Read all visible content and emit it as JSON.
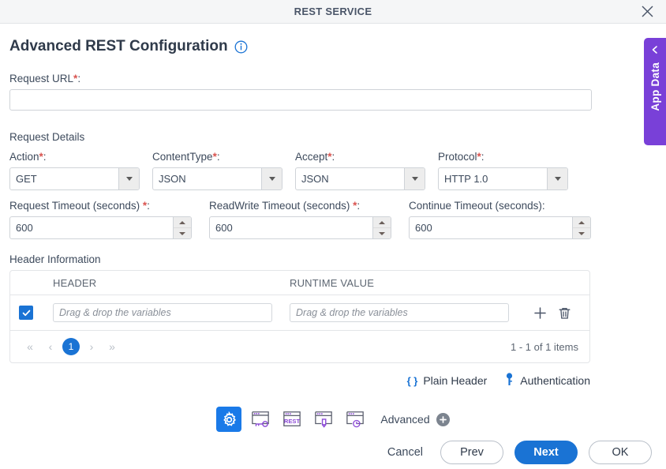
{
  "window": {
    "title": "REST SERVICE",
    "close_icon": "close-icon"
  },
  "page": {
    "title": "Advanced REST Configuration",
    "info_icon": "info-icon"
  },
  "request_url": {
    "label": "Request URL",
    "required_mark": "*",
    "colon": ":",
    "value": "",
    "placeholder": ""
  },
  "request_details": {
    "heading": "Request Details",
    "selects": [
      {
        "label": "Action",
        "required_mark": "*",
        "colon": ":",
        "value": "GET"
      },
      {
        "label": "ContentType",
        "required_mark": "*",
        "colon": ":",
        "value": "JSON"
      },
      {
        "label": "Accept",
        "required_mark": "*",
        "colon": ":",
        "value": "JSON"
      },
      {
        "label": "Protocol",
        "required_mark": "*",
        "colon": ":",
        "value": "HTTP 1.0"
      }
    ],
    "spinners": [
      {
        "label": "Request Timeout (seconds)",
        "required_mark": "*",
        "colon": ":",
        "value": "600"
      },
      {
        "label": "ReadWrite Timeout (seconds)",
        "required_mark": "*",
        "colon": ":",
        "value": "600"
      },
      {
        "label": "Continue Timeout (seconds)",
        "required_mark": "",
        "colon": ":",
        "value": "600"
      }
    ]
  },
  "header_information": {
    "heading": "Header Information",
    "columns": {
      "header": "HEADER",
      "runtime_value": "RUNTIME VALUE"
    },
    "rows": [
      {
        "checked": true,
        "header_value": "",
        "header_placeholder": "Drag & drop the variables",
        "runtime_value": "",
        "runtime_placeholder": "Drag & drop the variables",
        "add_icon": "plus-icon",
        "delete_icon": "trash-icon"
      }
    ],
    "pager": {
      "first": "«",
      "prev": "‹",
      "current_page": "1",
      "next": "›",
      "last": "»",
      "summary": "1 - 1 of 1 items"
    }
  },
  "links": [
    {
      "icon": "braces-icon",
      "label": "Plain Header"
    },
    {
      "icon": "key-icon",
      "label": "Authentication"
    }
  ],
  "toolbar": {
    "icons": [
      {
        "name": "gear-icon",
        "active": true
      },
      {
        "name": "window-key-icon",
        "active": false
      },
      {
        "name": "window-rest-icon",
        "active": false,
        "badge": "REST"
      },
      {
        "name": "window-pen-icon",
        "active": false
      },
      {
        "name": "window-clock-icon",
        "active": false
      }
    ],
    "advanced_label": "Advanced",
    "advanced_icon": "plus-circle-icon"
  },
  "footer": {
    "cancel": "Cancel",
    "prev": "Prev",
    "next": "Next",
    "ok": "OK"
  },
  "app_data_tab": {
    "label": "App Data",
    "chevron_icon": "chevron-left-icon"
  },
  "colors": {
    "accent_blue": "#1a73d4",
    "purple": "#7940d8",
    "required_red": "#d9534f",
    "text": "#3d4a5c",
    "titlebar_bg": "#f5f6f7"
  }
}
